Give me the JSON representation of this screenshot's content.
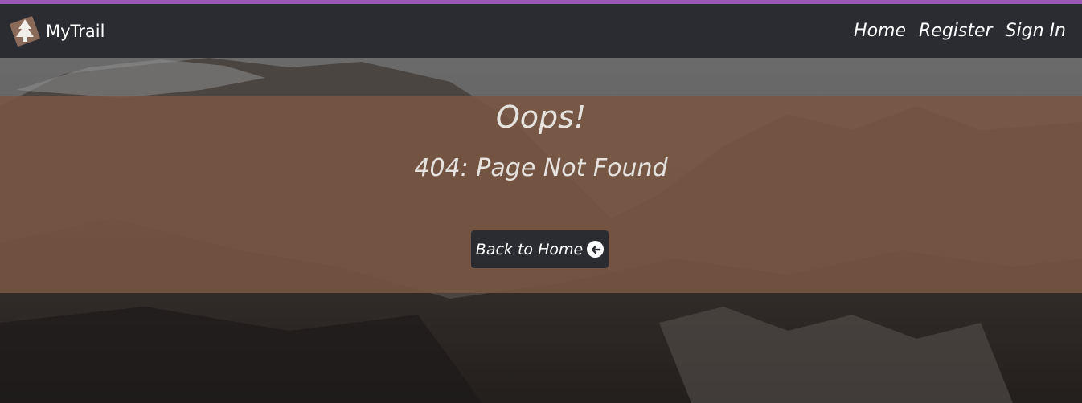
{
  "header": {
    "brand": "MyTrail",
    "nav": [
      {
        "label": "Home"
      },
      {
        "label": "Register"
      },
      {
        "label": "Sign In"
      }
    ]
  },
  "error": {
    "title": "Oops!",
    "message": "404: Page Not Found",
    "back_button_label": "Back to Home"
  },
  "icons": {
    "logo": "tree-icon",
    "back": "arrow-circle-left-icon"
  },
  "colors": {
    "accent": "#9b59b6",
    "navbar": "#2b2c31",
    "overlay": "#7a5642",
    "button": "#2b2c31"
  }
}
